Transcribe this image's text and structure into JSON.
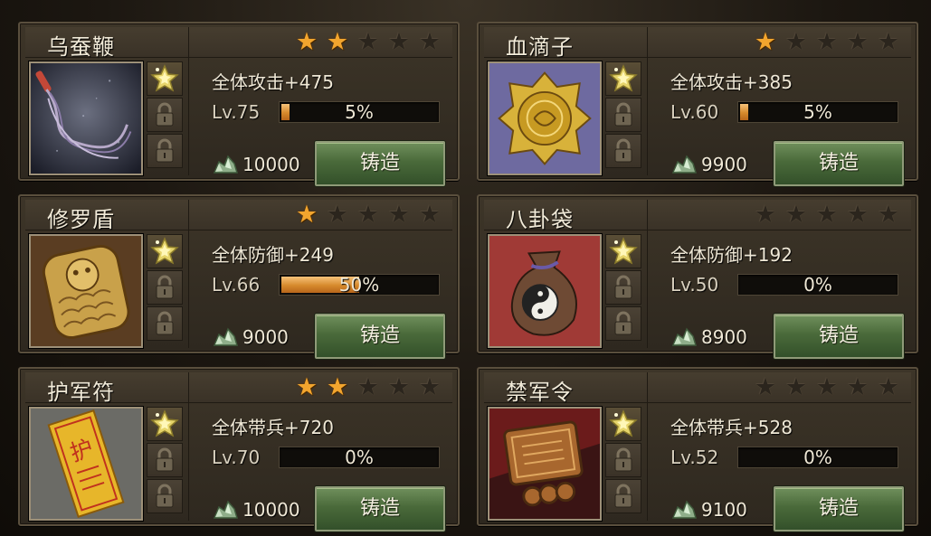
{
  "items": [
    {
      "name": "乌蚕鞭",
      "stars_on": 2,
      "stat": "全体攻击+475",
      "level": "Lv.75",
      "progress": 0.05,
      "progress_text": "5%",
      "cost": "10000",
      "button": "铸造",
      "portrait": "whip"
    },
    {
      "name": "血滴子",
      "stars_on": 1,
      "stat": "全体攻击+385",
      "level": "Lv.60",
      "progress": 0.05,
      "progress_text": "5%",
      "cost": "9900",
      "button": "铸造",
      "portrait": "gold-disc"
    },
    {
      "name": "修罗盾",
      "stars_on": 1,
      "stat": "全体防御+249",
      "level": "Lv.66",
      "progress": 0.5,
      "progress_text": "50%",
      "cost": "9000",
      "button": "铸造",
      "portrait": "shield"
    },
    {
      "name": "八卦袋",
      "stars_on": 0,
      "stat": "全体防御+192",
      "level": "Lv.50",
      "progress": 0,
      "progress_text": "0%",
      "cost": "8900",
      "button": "铸造",
      "portrait": "pouch"
    },
    {
      "name": "护军符",
      "stars_on": 2,
      "stat": "全体带兵+720",
      "level": "Lv.70",
      "progress": 0,
      "progress_text": "0%",
      "cost": "10000",
      "button": "铸造",
      "portrait": "talisman"
    },
    {
      "name": "禁军令",
      "stars_on": 0,
      "stat": "全体带兵+528",
      "level": "Lv.52",
      "progress": 0,
      "progress_text": "0%",
      "cost": "9100",
      "button": "铸造",
      "portrait": "token"
    }
  ],
  "max_stars": 5,
  "icons": {
    "gem_slot": "gem-slot-icon",
    "locked_slot": "lock-icon",
    "cost": "jade-ore-icon",
    "star": "star-icon"
  },
  "colors": {
    "star_on": "#f2a52e",
    "progress": "#d68a2c",
    "button": "#4a6a3a"
  }
}
